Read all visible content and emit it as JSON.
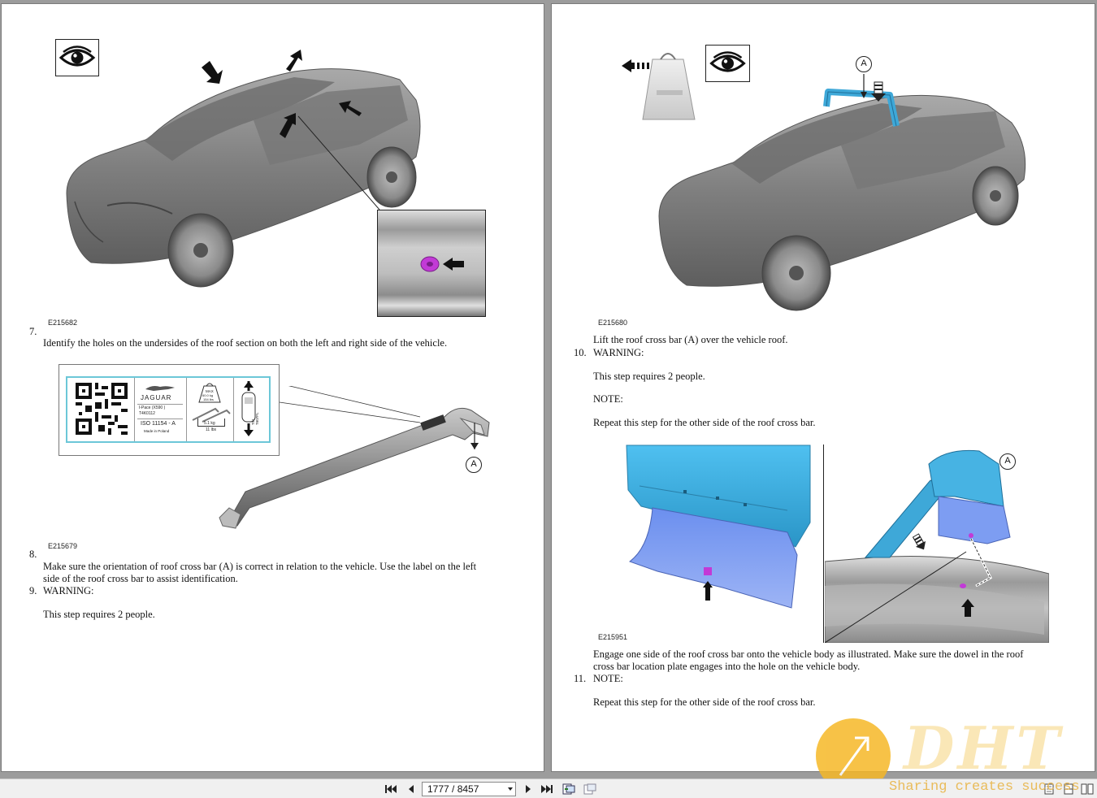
{
  "left_page": {
    "figure1_id": "E215682",
    "step7_number": "7.",
    "step7_text": "Identify the holes on the undersides of the roof section on both the left and right side of the vehicle.",
    "label": {
      "brand": "JAGUAR",
      "model_line1": "I-Pace  (X590 )",
      "model_line2": "T4K0112",
      "iso": "ISO 11154 - A",
      "made_in": "Made in Poland",
      "max_weight": "MAX",
      "max_kg": "60.0 kg",
      "max_lbs": "154 lbs",
      "bar_kg": "5.1 kg",
      "bar_lbs": "11 lbs",
      "vertical_code": "T51 T607FL"
    },
    "figure2_callout": "A",
    "figure2_id": "E215679",
    "step8_number": "8.",
    "step8_line1": "Make sure the orientation of roof cross bar (A) is correct in relation to the vehicle. Use the label on the left",
    "step8_line2": "side of the roof cross bar to assist identification.",
    "step9_number": "9.",
    "step9_heading": "WARNING:",
    "step9_text": "This step requires 2 people."
  },
  "right_page": {
    "figure1_callout": "A",
    "figure1_id": "E215680",
    "lift_text": "Lift the roof cross bar (A) over the vehicle roof.",
    "step10_number": "10.",
    "step10_heading": "WARNING:",
    "step10_text": "This step requires 2 people.",
    "step10_note_heading": "NOTE:",
    "step10_note_text": "Repeat this step for the other side of the roof cross bar.",
    "figure2_callout": "A",
    "figure2_id": "E215951",
    "engage_line1": "Engage one side of the roof cross bar onto the vehicle body as illustrated. Make sure the dowel in the roof",
    "engage_line2": "cross bar location plate engages into the hole on the vehicle body.",
    "step11_number": "11.",
    "step11_heading": "NOTE:",
    "step11_text": "Repeat this step for the other side of the roof cross bar."
  },
  "toolbar": {
    "page_indicator": "1777 / 8457",
    "icons": [
      "first-page-icon",
      "previous-page-icon",
      "next-page-icon",
      "last-page-icon",
      "fit-page-icon",
      "fit-width-icon",
      "single-page-icon",
      "two-page-icon"
    ]
  },
  "watermark": {
    "logo": "DHT",
    "tagline": "Sharing creates success"
  },
  "colors": {
    "cross_bar_blue": "#3ea8d8",
    "plate_blue": "#7d9df2",
    "dowel_magenta": "#c23ad6",
    "label_border": "#6cc7d8",
    "watermark_orange": "#f6b827"
  }
}
